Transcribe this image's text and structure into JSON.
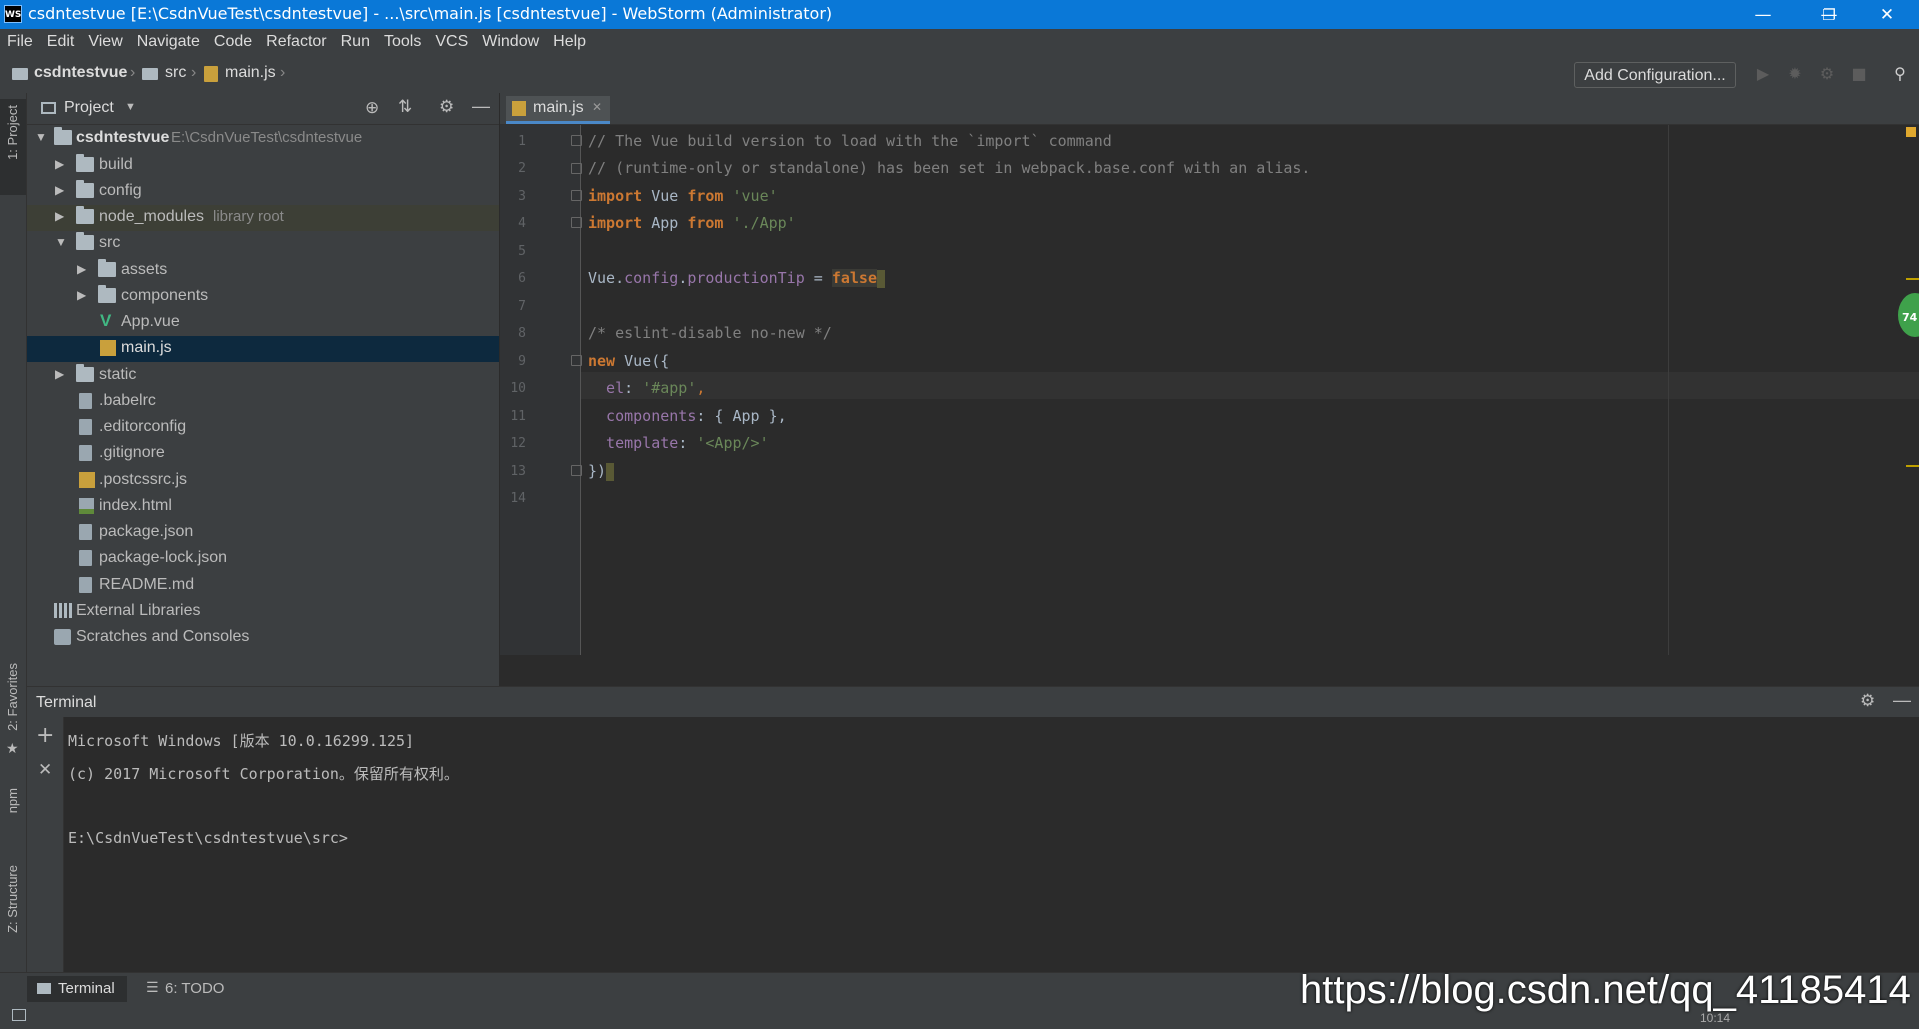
{
  "window": {
    "app_icon": "WS",
    "title": "csdntestvue [E:\\CsdnVueTest\\csdntestvue] - ...\\src\\main.js [csdntestvue] - WebStorm (Administrator)",
    "minimize": "—",
    "restore": "❐",
    "close": "✕"
  },
  "menu": [
    "File",
    "Edit",
    "View",
    "Navigate",
    "Code",
    "Refactor",
    "Run",
    "Tools",
    "VCS",
    "Window",
    "Help"
  ],
  "breadcrumb": {
    "project": "csdntestvue",
    "folder": "src",
    "file": "main.js"
  },
  "toolbar": {
    "add_configuration": "Add Configuration..."
  },
  "left_stripe": {
    "project": "1: Project",
    "favorites": "2: Favorites",
    "npm": "npm",
    "structure": "Z: Structure"
  },
  "project_panel": {
    "title": "Project",
    "root": {
      "name": "csdntestvue",
      "path": "E:\\CsdnVueTest\\csdntestvue"
    },
    "items": [
      {
        "name": "build"
      },
      {
        "name": "config"
      },
      {
        "name": "node_modules",
        "hint": "library root"
      },
      {
        "name": "src"
      },
      {
        "name": "assets"
      },
      {
        "name": "components"
      },
      {
        "name": "App.vue"
      },
      {
        "name": "main.js"
      },
      {
        "name": "static"
      },
      {
        "name": ".babelrc"
      },
      {
        "name": ".editorconfig"
      },
      {
        "name": ".gitignore"
      },
      {
        "name": ".postcssrc.js"
      },
      {
        "name": "index.html"
      },
      {
        "name": "package.json"
      },
      {
        "name": "package-lock.json"
      },
      {
        "name": "README.md"
      },
      {
        "name": "External Libraries"
      },
      {
        "name": "Scratches and Consoles"
      }
    ]
  },
  "editor": {
    "tab": "main.js",
    "line_numbers": [
      "1",
      "2",
      "3",
      "4",
      "5",
      "6",
      "7",
      "8",
      "9",
      "10",
      "11",
      "12",
      "13",
      "14"
    ],
    "lines": {
      "l1": "// The Vue build version to load with the `import` command",
      "l2": "// (runtime-only or standalone) has been set in webpack.base.conf with an alias.",
      "l3_kw": "import",
      "l3_id": " Vue ",
      "l3_from": "from",
      "l3_str": " 'vue'",
      "l4_kw": "import",
      "l4_id": " App ",
      "l4_from": "from",
      "l4_str": " './App'",
      "l6_a": "Vue.",
      "l6_b": "config",
      "l6_c": ".",
      "l6_d": "productionTip",
      "l6_e": " = ",
      "l6_f": "false",
      "l8": "/* eslint-disable no-new */",
      "l9_kw": "new",
      "l9_rest": " Vue({",
      "l10_prop": "  el",
      "l10_colon": ": ",
      "l10_str": "'#app'",
      "l10_end": ",",
      "l11_prop": "  components",
      "l11_rest": ": { App },",
      "l12_prop": "  template",
      "l12_colon": ": ",
      "l12_str": "'<App/>'",
      "l13": "})"
    },
    "inspection_badge": "74"
  },
  "terminal": {
    "title": "Terminal",
    "lines": [
      "Microsoft Windows [版本 10.0.16299.125]",
      "(c) 2017 Microsoft Corporation。保留所有权利。",
      "",
      "E:\\CsdnVueTest\\csdntestvue\\src>"
    ]
  },
  "bottom_tabs": {
    "terminal": "Terminal",
    "todo": "6: TODO"
  },
  "status": {
    "position": "10:14"
  },
  "watermark": "https://blog.csdn.net/qq_41185414"
}
